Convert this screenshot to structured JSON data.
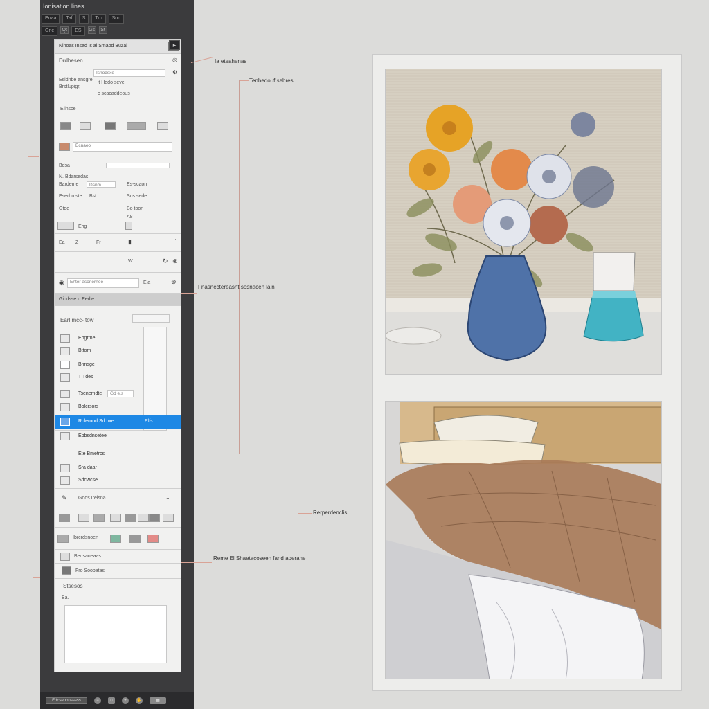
{
  "app": {
    "title": "Ionisation lines"
  },
  "toolbar": {
    "row1": [
      "Enaa",
      "Taf",
      "S",
      "Tro",
      "Son"
    ],
    "row2": [
      "Gne",
      "Qt",
      "ES",
      "Gs",
      "St"
    ]
  },
  "panel": {
    "header": "Ninoas Insad is al Smaod Buzal",
    "section1": {
      "title": "Drdhesen",
      "field1_value": "Isnodsxe",
      "desc_lines": [
        "Esidnbe ansgre",
        "Brstlupigr,"
      ],
      "note": "'t Hedo seve",
      "note2": "c scacaddeous",
      "sub": "Elinsce"
    },
    "section2": {
      "input_value": "Ecnaeo"
    },
    "section3": {
      "label": "Bdsa",
      "row_a": "N. Bdarsedas",
      "row_b_left": "Bardeme",
      "row_b_mid": "Dsnm",
      "row_b_right": "Es-scaon",
      "row_c_left": "Eserhn ste",
      "row_c_mid": "Bst",
      "row_c_right": "Sos sede",
      "row_d_left": "Gtde",
      "row_d_right": "Bo toon",
      "row_e": "A8",
      "row_f": "Ehg"
    },
    "section4": {
      "icons": [
        "Ea",
        "Z",
        "Fr"
      ]
    },
    "section5": {
      "value": "W."
    },
    "section6": {
      "search_value": "Enter asonernee",
      "btn": "Ela"
    },
    "section_bar": "Gicdsse u Eedle",
    "section7": {
      "label": "Earl mcc- tow",
      "items": [
        {
          "label": "Ebgrme"
        },
        {
          "label": "Bttom"
        },
        {
          "label": "Bnnsge"
        },
        {
          "label": "T Tdes"
        },
        {
          "label": "Tsenemdte",
          "badge": "Gd e.s"
        },
        {
          "label": "Bolcrsors"
        },
        {
          "label": "Rcleroud Sd bxe",
          "badge": "Elfs",
          "selected": true
        },
        {
          "label": "Ebbsdnsetee"
        },
        {
          "label": "Ete Bmetrcs"
        },
        {
          "label": "Sra daar"
        },
        {
          "label": "Sdcwcse"
        }
      ]
    },
    "section8": {
      "label": "Goos Ireisna"
    },
    "section9": {
      "label": "Ibrcrdsnoen"
    },
    "section10": {
      "label": "Bedsaneaas"
    },
    "section11": {
      "label": "Fro Soobatas"
    },
    "section12": {
      "label": "Stsesos",
      "sub": "Ba."
    }
  },
  "statusbar": {
    "label": "Edcseoonsssss"
  },
  "callouts": [
    {
      "text": "Ia eteahenas"
    },
    {
      "text": "Tenhedouf sebres"
    },
    {
      "text": "Fnasnectereasnt sosnacen lain"
    },
    {
      "text": "Rerperdenclis"
    },
    {
      "text": "Reme El Shaetacoseen fand aoerane"
    }
  ],
  "colors": {
    "accent": "#1e88e5",
    "callout_line": "#d9a396",
    "sidebar": "#3b3b3d"
  }
}
